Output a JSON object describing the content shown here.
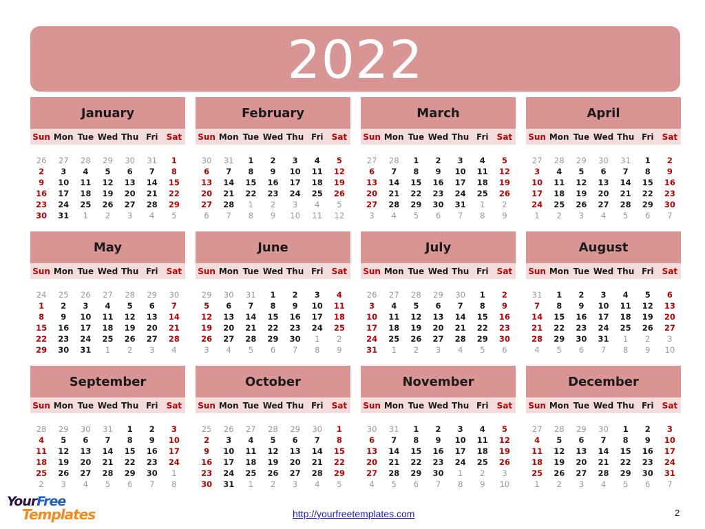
{
  "year": "2022",
  "weekdays": [
    "Sun",
    "Mon",
    "Tue",
    "Wed",
    "Thu",
    "Fri",
    "Sat"
  ],
  "months": [
    {
      "name": "January",
      "weeks": [
        [
          26,
          27,
          28,
          29,
          30,
          31,
          1
        ],
        [
          2,
          3,
          4,
          5,
          6,
          7,
          8
        ],
        [
          9,
          10,
          11,
          12,
          13,
          14,
          15
        ],
        [
          16,
          17,
          18,
          19,
          20,
          21,
          22
        ],
        [
          23,
          24,
          25,
          26,
          27,
          28,
          29
        ],
        [
          30,
          31,
          1,
          2,
          3,
          4,
          5
        ]
      ],
      "lead": 6,
      "days": 31
    },
    {
      "name": "February",
      "weeks": [
        [
          30,
          31,
          1,
          2,
          3,
          4,
          5
        ],
        [
          6,
          7,
          8,
          9,
          10,
          11,
          12
        ],
        [
          13,
          14,
          15,
          16,
          17,
          18,
          19
        ],
        [
          20,
          21,
          22,
          23,
          24,
          25,
          26
        ],
        [
          27,
          28,
          1,
          2,
          3,
          4,
          5
        ],
        [
          6,
          7,
          8,
          9,
          10,
          11,
          12
        ]
      ],
      "lead": 2,
      "days": 28
    },
    {
      "name": "March",
      "weeks": [
        [
          27,
          28,
          1,
          2,
          3,
          4,
          5
        ],
        [
          6,
          7,
          8,
          9,
          10,
          11,
          12
        ],
        [
          13,
          14,
          15,
          16,
          17,
          18,
          19
        ],
        [
          20,
          21,
          22,
          23,
          24,
          25,
          26
        ],
        [
          27,
          28,
          29,
          30,
          31,
          1,
          2
        ],
        [
          3,
          4,
          5,
          6,
          7,
          8,
          9
        ]
      ],
      "lead": 2,
      "days": 31
    },
    {
      "name": "April",
      "weeks": [
        [
          27,
          28,
          29,
          30,
          31,
          1,
          2
        ],
        [
          3,
          4,
          5,
          6,
          7,
          8,
          9
        ],
        [
          10,
          11,
          12,
          13,
          14,
          15,
          16
        ],
        [
          17,
          18,
          19,
          20,
          21,
          22,
          23
        ],
        [
          24,
          25,
          26,
          27,
          28,
          29,
          30
        ],
        [
          1,
          2,
          3,
          4,
          5,
          6,
          7
        ]
      ],
      "lead": 5,
      "days": 30
    },
    {
      "name": "May",
      "weeks": [
        [
          24,
          25,
          26,
          27,
          28,
          29,
          30
        ],
        [
          1,
          2,
          3,
          4,
          5,
          6,
          7
        ],
        [
          8,
          9,
          10,
          11,
          12,
          13,
          14
        ],
        [
          15,
          16,
          17,
          18,
          19,
          20,
          21
        ],
        [
          22,
          23,
          24,
          25,
          26,
          27,
          28
        ],
        [
          29,
          30,
          31,
          1,
          2,
          3,
          4
        ]
      ],
      "lead": 7,
      "days": 31
    },
    {
      "name": "June",
      "weeks": [
        [
          29,
          30,
          31,
          1,
          2,
          3,
          4
        ],
        [
          5,
          6,
          7,
          8,
          9,
          10,
          11
        ],
        [
          12,
          13,
          14,
          15,
          16,
          17,
          18
        ],
        [
          19,
          20,
          21,
          22,
          23,
          24,
          25
        ],
        [
          26,
          27,
          28,
          29,
          30,
          1,
          2
        ],
        [
          3,
          4,
          5,
          6,
          7,
          8,
          9
        ]
      ],
      "lead": 3,
      "days": 30
    },
    {
      "name": "July",
      "weeks": [
        [
          26,
          27,
          28,
          29,
          30,
          1,
          2
        ],
        [
          3,
          4,
          5,
          6,
          7,
          8,
          9
        ],
        [
          10,
          11,
          12,
          13,
          14,
          15,
          16
        ],
        [
          17,
          18,
          19,
          20,
          21,
          22,
          23
        ],
        [
          24,
          25,
          26,
          27,
          28,
          29,
          30
        ],
        [
          31,
          1,
          2,
          3,
          4,
          5,
          6
        ]
      ],
      "lead": 5,
      "days": 31
    },
    {
      "name": "August",
      "weeks": [
        [
          31,
          1,
          2,
          3,
          4,
          5,
          6
        ],
        [
          7,
          8,
          9,
          10,
          11,
          12,
          13
        ],
        [
          14,
          15,
          16,
          17,
          18,
          19,
          20
        ],
        [
          21,
          22,
          23,
          24,
          25,
          26,
          27
        ],
        [
          28,
          29,
          30,
          31,
          1,
          2,
          3
        ],
        [
          4,
          5,
          6,
          7,
          8,
          9,
          10
        ]
      ],
      "lead": 1,
      "days": 31
    },
    {
      "name": "September",
      "weeks": [
        [
          28,
          29,
          30,
          31,
          1,
          2,
          3
        ],
        [
          4,
          5,
          6,
          7,
          8,
          9,
          10
        ],
        [
          11,
          12,
          13,
          14,
          15,
          16,
          17
        ],
        [
          18,
          19,
          20,
          21,
          22,
          23,
          24
        ],
        [
          25,
          26,
          27,
          28,
          29,
          30,
          1
        ],
        [
          2,
          3,
          4,
          5,
          6,
          7,
          8
        ]
      ],
      "lead": 4,
      "days": 30
    },
    {
      "name": "October",
      "weeks": [
        [
          25,
          26,
          27,
          28,
          29,
          30,
          1
        ],
        [
          2,
          3,
          4,
          5,
          6,
          7,
          8
        ],
        [
          9,
          10,
          11,
          12,
          13,
          14,
          15
        ],
        [
          16,
          17,
          18,
          19,
          20,
          21,
          22
        ],
        [
          23,
          24,
          25,
          26,
          27,
          28,
          29
        ],
        [
          30,
          31,
          1,
          2,
          3,
          4,
          5
        ]
      ],
      "lead": 6,
      "days": 31
    },
    {
      "name": "November",
      "weeks": [
        [
          30,
          31,
          1,
          2,
          3,
          4,
          5
        ],
        [
          6,
          7,
          8,
          9,
          10,
          11,
          12
        ],
        [
          13,
          14,
          15,
          16,
          17,
          18,
          19
        ],
        [
          20,
          21,
          22,
          23,
          24,
          25,
          26
        ],
        [
          27,
          28,
          29,
          30,
          1,
          2,
          3
        ],
        [
          4,
          5,
          6,
          7,
          8,
          9,
          10
        ]
      ],
      "lead": 2,
      "days": 30
    },
    {
      "name": "December",
      "weeks": [
        [
          27,
          28,
          29,
          30,
          1,
          2,
          3
        ],
        [
          4,
          5,
          6,
          7,
          8,
          9,
          10
        ],
        [
          11,
          12,
          13,
          14,
          15,
          16,
          17
        ],
        [
          18,
          19,
          20,
          21,
          22,
          23,
          24
        ],
        [
          25,
          26,
          27,
          28,
          29,
          30,
          31
        ],
        [
          1,
          2,
          3,
          4,
          5,
          6,
          7
        ]
      ],
      "lead": 4,
      "days": 31
    }
  ],
  "colors": {
    "band": "#d99494",
    "weekday_band": "#f3dcdc",
    "weekend": "#c00000",
    "other_month": "#9a9a9a"
  },
  "footer": {
    "logo_line1_a": "Your",
    "logo_line1_b": "Free",
    "logo_line2": "Templates",
    "url": "http://yourfreetemplates.com",
    "page_number": "2"
  }
}
